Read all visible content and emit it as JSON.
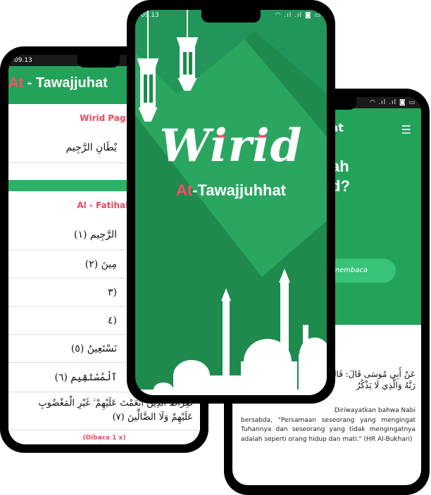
{
  "colors": {
    "green": "#23a25a",
    "accent": "#ff4d6a",
    "dark_green": "#1e8a4e"
  },
  "left_phone": {
    "time": "09.13",
    "title_accent": "At",
    "title_rest": " - Tawajjuhat",
    "section1": "Wirid Pagi",
    "ayat_taawudz": "يْطَانِ الرَّجِيم",
    "section2": "Al - Fatihah",
    "rows": [
      "الرَّجِيم (١)",
      "مِينَ (٢)",
      "(٣",
      "(٤",
      "نَسْتَعِينُ (٥)",
      "ٱلْمُسْتَقِيم (٦)"
    ],
    "row7a": "صِرَاطَ الَّذِينَ أَنْعَمْتَ عَلَيْهِمْ ۙ غَيْرِ الْمَغْضُوبِ",
    "row7b": "عَلَيْهِمْ وَلَا الضَّالِّينَ (٧)",
    "note": "(Dibaca 1 x)"
  },
  "center_phone": {
    "time": "09.13",
    "status_icons": "◠ .ıl .ıl ◙ ▭",
    "logo": "Wirid",
    "sub_accent": "At",
    "sub_rest": "-Tawajjuhhat"
  },
  "right_phone": {
    "status_icons": "◠ .ıl .ıl ◙ ▭",
    "appbar_title": "hat",
    "menu_icon": "menu-icon",
    "hero_line1": "ah",
    "hero_line2": "d?",
    "button_label": "membaca",
    "hadith_ar": "عَنْ أَبِي مُوسَى قَالَ: قَالَ رَسُولُ اللهِ ... مَثَلُ الَّذِي يَذْكُرُ رَبَّهُ وَالَّذِي لَا يَذْكُرُ",
    "hadith_id_line1": "Diriwayatkan bahwa Nabi",
    "hadith_id_rest": "bersabda, \"Persamaan seseorang yang mengingat Tuhannya dan seseorang yang tidak mengingatnya adalah seperti orang hidup dan mati.\" (HR Al-Bukhari)"
  }
}
